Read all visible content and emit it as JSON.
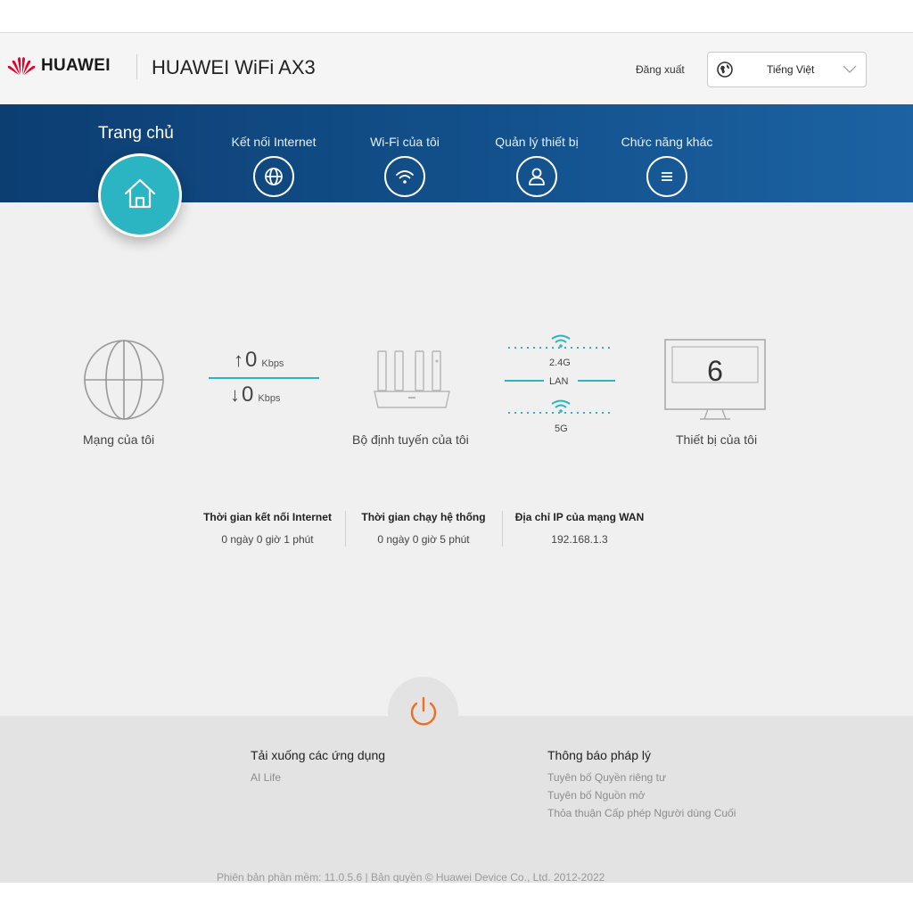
{
  "header": {
    "brand": "HUAWEI",
    "product": "HUAWEI WiFi AX3",
    "logout_label": "Đăng xuất",
    "language": "Tiếng Việt"
  },
  "nav": {
    "home": "Trang chủ",
    "items": [
      {
        "label": "Kết nối Internet",
        "icon": "globe-icon"
      },
      {
        "label": "Wi-Fi của tôi",
        "icon": "wifi-icon"
      },
      {
        "label": "Quản lý thiết bị",
        "icon": "user-icon"
      },
      {
        "label": "Chức năng khác",
        "icon": "menu-icon"
      }
    ]
  },
  "topology": {
    "network_label": "Mạng của tôi",
    "upload_value": "0",
    "upload_unit": "Kbps",
    "download_value": "0",
    "download_unit": "Kbps",
    "router_label": "Bộ định tuyến của tôi",
    "band_24": "2.4G",
    "lan": "LAN",
    "band_5": "5G",
    "device_count": "6",
    "devices_label": "Thiết bị của tôi"
  },
  "info": [
    {
      "title": "Thời gian kết nối Internet",
      "value": "0 ngày 0 giờ 1 phút"
    },
    {
      "title": "Thời gian chạy hệ thống",
      "value": "0 ngày 0 giờ 5 phút"
    },
    {
      "title": "Địa chỉ IP của mạng WAN",
      "value": "192.168.1.3"
    }
  ],
  "footer": {
    "apps_title": "Tải xuống các ứng dụng",
    "apps": [
      "AI Life"
    ],
    "legal_title": "Thông báo pháp lý",
    "legal_links": [
      "Tuyên bố Quyền riêng tư",
      "Tuyên bố Nguồn mở",
      "Thỏa thuận Cấp phép Người dùng Cuối"
    ],
    "copyright": "Phiên bản phần mềm: 11.0.5.6 |  Bản quyền © Huawei Device Co., Ltd. 2012-2022"
  },
  "colors": {
    "accent": "#2bb5c2",
    "nav_bg": "#13518c",
    "power": "#f06e22",
    "logo_red": "#e4002b"
  }
}
